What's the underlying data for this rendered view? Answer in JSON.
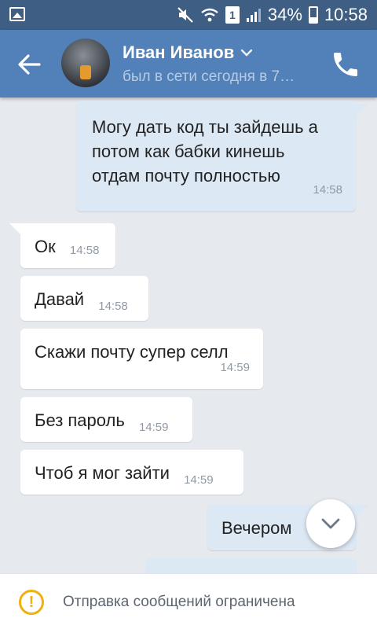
{
  "status_bar": {
    "battery_percent": "34%",
    "time": "10:58",
    "sim": "1",
    "icons": [
      "gallery-icon",
      "mute-icon",
      "wifi-icon",
      "sim-icon",
      "signal-icon",
      "battery-icon"
    ]
  },
  "header": {
    "name": "Иван Иванов",
    "status": "был в сети сегодня в 7…",
    "icons": [
      "back-arrow-icon",
      "chevron-down-icon",
      "phone-icon"
    ],
    "accent_color": "#5181b8"
  },
  "messages": [
    {
      "direction": "out",
      "text": "Могу дать код ты зайдешь а потом как бабки кинешь отдам почту полностью",
      "time": "14:58"
    },
    {
      "direction": "in",
      "text": "Ок",
      "time": "14:58"
    },
    {
      "direction": "in",
      "text": "Давай",
      "time": "14:58"
    },
    {
      "direction": "in",
      "text": "Скажи почту супер селл",
      "time": "14:59"
    },
    {
      "direction": "in",
      "text": "Без пароль",
      "time": "14:59"
    },
    {
      "direction": "in",
      "text": "Чтоб я мог зайти",
      "time": "14:59"
    },
    {
      "direction": "out",
      "text": "Вечером",
      "time": ""
    }
  ],
  "scroll_button": {
    "icon": "chevron-down-icon"
  },
  "footer": {
    "icon": "warning-icon",
    "text": "Отправка сообщений ограничена",
    "icon_color": "#f0b00f"
  }
}
